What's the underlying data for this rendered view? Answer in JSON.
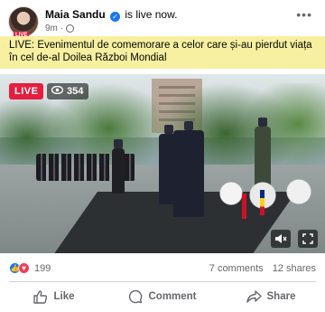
{
  "post": {
    "author": "Maia Sandu",
    "status_text": "is live now.",
    "time": "9m",
    "separator": "·",
    "avatar_tag": "LIVE",
    "caption": "LIVE: Evenimentul de comemorare a celor care și-au pierdut viața în cel de-al Doilea Război Mondial"
  },
  "video": {
    "live_label": "LIVE",
    "viewer_count": "354"
  },
  "stats": {
    "reaction_count": "199",
    "comments": "7 comments",
    "shares": "12 shares"
  },
  "actions": {
    "like": "Like",
    "comment": "Comment",
    "share": "Share"
  },
  "icons": {
    "more": "more-options-icon",
    "verified": "verified-badge-icon",
    "audience": "globe-icon",
    "viewers": "eye-icon",
    "mute": "speaker-muted-icon",
    "fullscreen": "fullscreen-icon"
  },
  "colors": {
    "live_red": "#e41e3f",
    "brand_blue": "#1877f2",
    "caption_highlight": "#f7f0a0"
  }
}
